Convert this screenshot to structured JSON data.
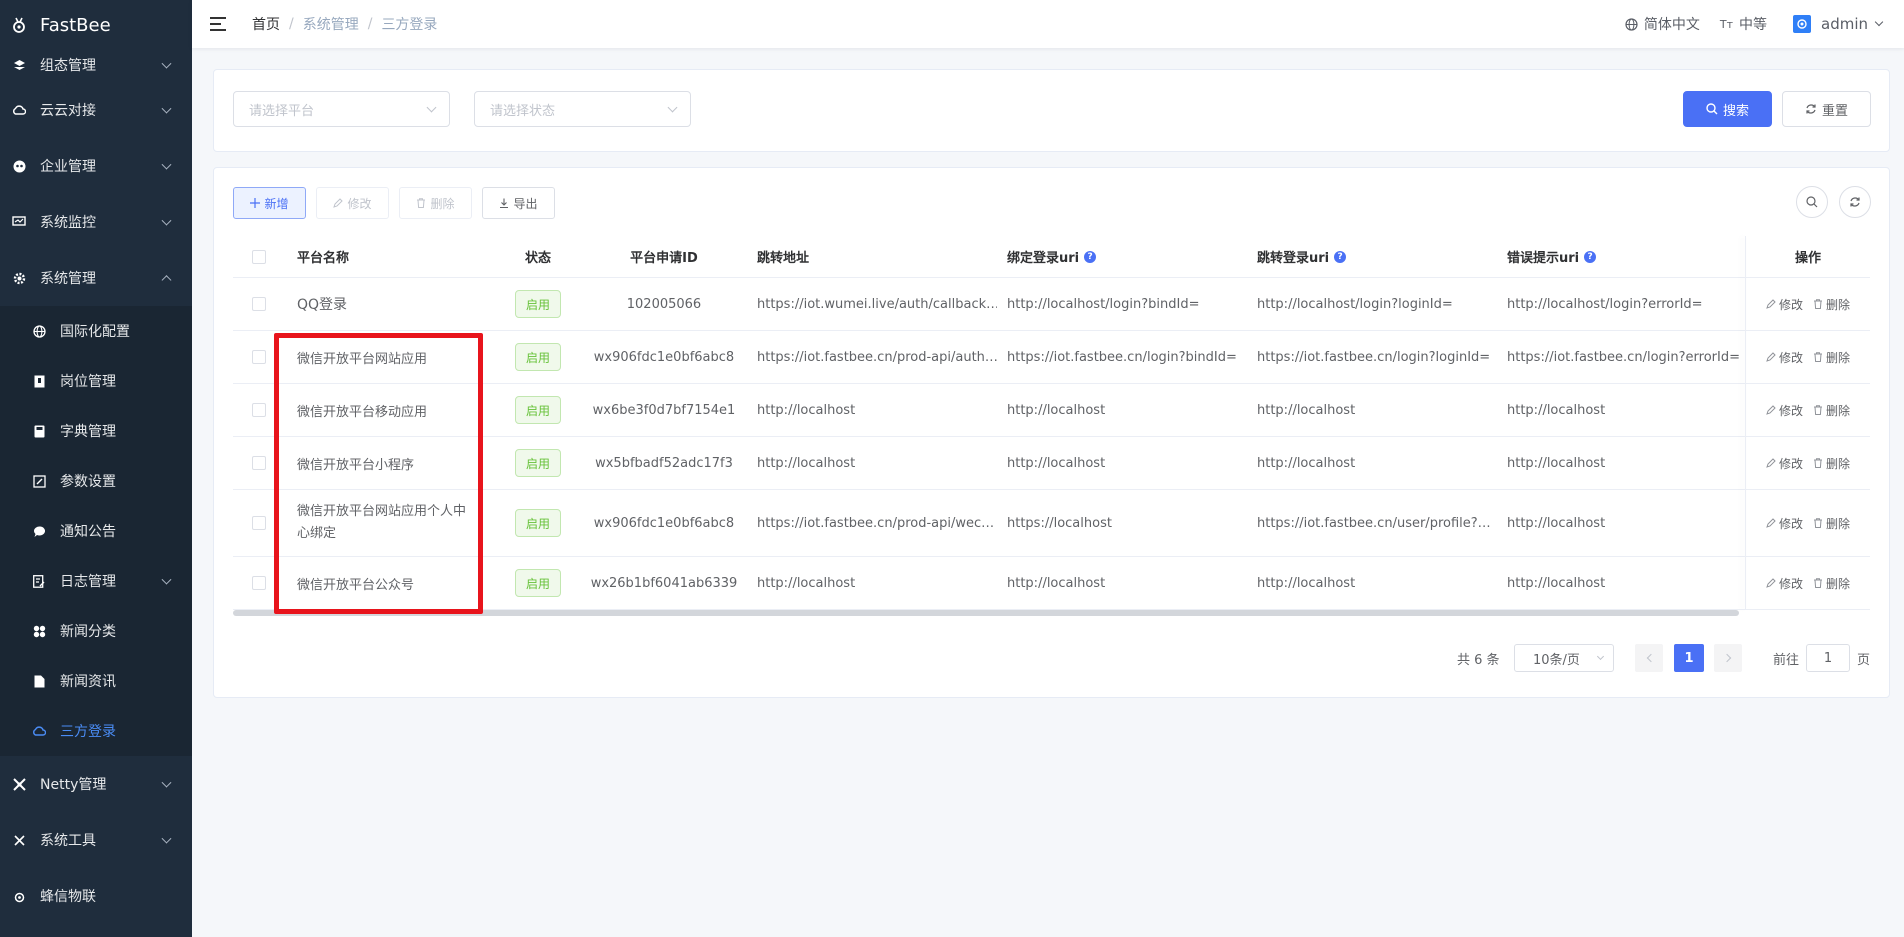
{
  "app": {
    "logo_text": "FastBee"
  },
  "sidebar": {
    "items": [
      {
        "label": "组态管理"
      },
      {
        "label": "云云对接"
      },
      {
        "label": "企业管理"
      },
      {
        "label": "系统监控"
      },
      {
        "label": "系统管理"
      }
    ],
    "subitems": [
      {
        "label": "国际化配置"
      },
      {
        "label": "岗位管理"
      },
      {
        "label": "字典管理"
      },
      {
        "label": "参数设置"
      },
      {
        "label": "通知公告"
      },
      {
        "label": "日志管理"
      },
      {
        "label": "新闻分类"
      },
      {
        "label": "新闻资讯"
      },
      {
        "label": "三方登录"
      }
    ],
    "bottom_items": [
      {
        "label": "Netty管理"
      },
      {
        "label": "系统工具"
      },
      {
        "label": "蜂信物联"
      }
    ]
  },
  "header": {
    "breadcrumb": [
      "首页",
      "系统管理",
      "三方登录"
    ],
    "breadcrumb_sep": "/",
    "language": "简体中文",
    "size_icon": "Tт",
    "size": "中等",
    "username": "admin"
  },
  "search": {
    "platform_placeholder": "请选择平台",
    "status_placeholder": "请选择状态",
    "search_label": "搜索",
    "reset_label": "重置"
  },
  "toolbar": {
    "add_label": "新增",
    "edit_label": "修改",
    "delete_label": "删除",
    "export_label": "导出"
  },
  "table": {
    "columns": {
      "name": "平台名称",
      "status": "状态",
      "app_id": "平台申请ID",
      "redirect": "跳转地址",
      "bind_uri": "绑定登录uri",
      "login_uri": "跳转登录uri",
      "error_uri": "错误提示uri",
      "actions": "操作"
    },
    "help_glyph": "?",
    "rows": [
      {
        "name": "QQ登录",
        "status": "启用",
        "app_id": "102005066",
        "redirect": "https://iot.wumei.live/auth/callback…",
        "bind_uri": "http://localhost/login?bindId=",
        "login_uri": "http://localhost/login?loginId=",
        "error_uri": "http://localhost/login?errorId="
      },
      {
        "name": "微信开放平台网站应用",
        "status": "启用",
        "app_id": "wx906fdc1e0bf6abc8",
        "redirect": "https://iot.fastbee.cn/prod-api/auth…",
        "bind_uri": "https://iot.fastbee.cn/login?bindId=",
        "login_uri": "https://iot.fastbee.cn/login?loginId=",
        "error_uri": "https://iot.fastbee.cn/login?errorId="
      },
      {
        "name": "微信开放平台移动应用",
        "status": "启用",
        "app_id": "wx6be3f0d7bf7154e1",
        "redirect": "http://localhost",
        "bind_uri": "http://localhost",
        "login_uri": "http://localhost",
        "error_uri": "http://localhost"
      },
      {
        "name": "微信开放平台小程序",
        "status": "启用",
        "app_id": "wx5bfbadf52adc17f3",
        "redirect": "http://localhost",
        "bind_uri": "http://localhost",
        "login_uri": "http://localhost",
        "error_uri": "http://localhost"
      },
      {
        "name": "微信开放平台网站应用个人中心绑定",
        "status": "启用",
        "app_id": "wx906fdc1e0bf6abc8",
        "redirect": "https://iot.fastbee.cn/prod-api/wec…",
        "bind_uri": "https://localhost",
        "login_uri": "https://iot.fastbee.cn/user/profile?…",
        "error_uri": "http://localhost"
      },
      {
        "name": "微信开放平台公众号",
        "status": "启用",
        "app_id": "wx26b1bf6041ab6339",
        "redirect": "http://localhost",
        "bind_uri": "http://localhost",
        "login_uri": "http://localhost",
        "error_uri": "http://localhost"
      }
    ],
    "row_edit": "修改",
    "row_delete": "删除"
  },
  "pagination": {
    "total_text": "共 6 条",
    "page_size": "10条/页",
    "current_page": "1",
    "goto_label": "前往",
    "goto_value": "1",
    "page_suffix": "页"
  },
  "colors": {
    "primary": "#4a70f5",
    "sidebar_bg": "#1f2d3d",
    "active_menu": "#4a8cf5",
    "success": "#67c23a",
    "highlight": "#e8141c"
  }
}
